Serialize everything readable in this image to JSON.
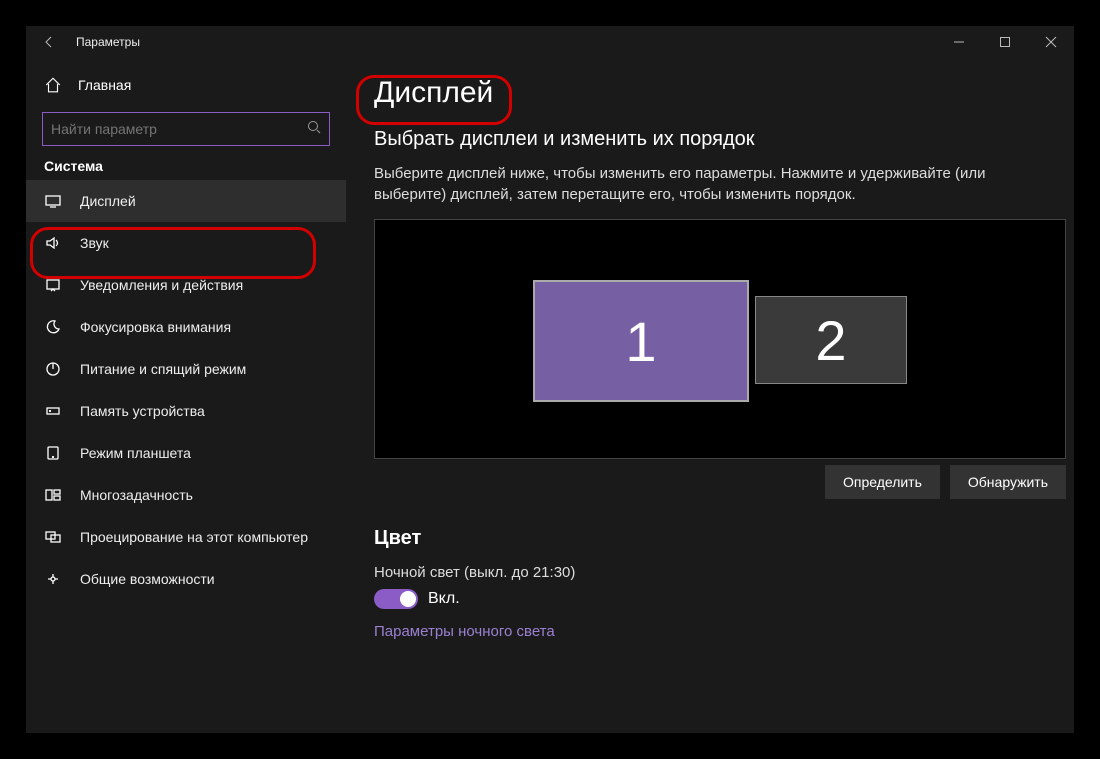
{
  "title_bar": {
    "app_title": "Параметры"
  },
  "sidebar": {
    "home_label": "Главная",
    "search_placeholder": "Найти параметр",
    "group_label": "Система",
    "items": [
      {
        "label": "Дисплей"
      },
      {
        "label": "Звук"
      },
      {
        "label": "Уведомления и действия"
      },
      {
        "label": "Фокусировка внимания"
      },
      {
        "label": "Питание и спящий режим"
      },
      {
        "label": "Память устройства"
      },
      {
        "label": "Режим планшета"
      },
      {
        "label": "Многозадачность"
      },
      {
        "label": "Проецирование на этот компьютер"
      },
      {
        "label": "Общие возможности"
      }
    ]
  },
  "main": {
    "page_title": "Дисплей",
    "sub_heading": "Выбрать дисплеи и изменить их порядок",
    "description": "Выберите дисплей ниже, чтобы изменить его параметры. Нажмите и удерживайте (или выберите) дисплей, затем перетащите его, чтобы изменить порядок.",
    "monitor1": "1",
    "monitor2": "2",
    "identify_btn": "Определить",
    "detect_btn": "Обнаружить",
    "color_heading": "Цвет",
    "night_light_label": "Ночной свет (выкл. до 21:30)",
    "toggle_state": "Вкл.",
    "night_light_link": "Параметры ночного света"
  }
}
